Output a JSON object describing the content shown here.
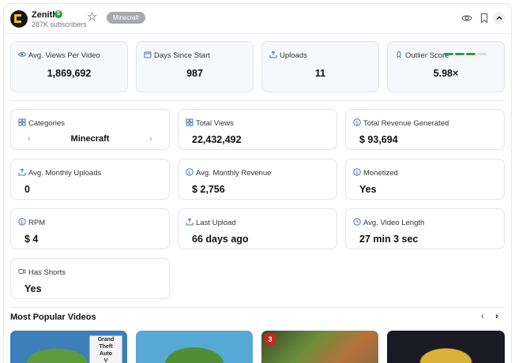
{
  "header": {
    "channel_name": "Zenith",
    "subscribers": "287K subscribers",
    "tag": "Minecraft",
    "verified_symbol": "$"
  },
  "top_stats": [
    {
      "label": "Avg. Views Per Video",
      "value": "1,869,692",
      "icon": "eye-icon"
    },
    {
      "label": "Days Since Start",
      "value": "987",
      "icon": "calendar-icon"
    },
    {
      "label": "Uploads",
      "value": "11",
      "icon": "upload-icon"
    },
    {
      "label": "Outlier Score",
      "value": "5.98×",
      "icon": "rocket-icon",
      "score_level": 0.75
    }
  ],
  "categories": {
    "label": "Categories",
    "value": "Minecraft"
  },
  "stats": [
    {
      "label": "Total Views",
      "value": "22,432,492",
      "icon": "grid-icon"
    },
    {
      "label": "Total Revenue Generated",
      "value": "$ 93,694",
      "icon": "dollar-icon"
    },
    {
      "label": "Avg. Monthly Uploads",
      "value": "0",
      "icon": "upload-icon"
    },
    {
      "label": "Avg. Monthly Revenue",
      "value": "$ 2,756",
      "icon": "dollar-icon"
    },
    {
      "label": "Monetized",
      "value": "Yes",
      "icon": "dollar-icon"
    },
    {
      "label": "RPM",
      "value": "$ 4",
      "icon": "dollar-icon"
    },
    {
      "label": "Last Upload",
      "value": "66 days ago",
      "icon": "upload-icon"
    },
    {
      "label": "Avg. Video Length",
      "value": "27 min 3 sec",
      "icon": "clock-icon"
    },
    {
      "label": "Has Shorts",
      "value": "Yes",
      "icon": "video-icon"
    }
  ],
  "popular": {
    "title": "Most Popular Videos",
    "thumb1_text": [
      "Grand",
      "Theft",
      "Auto",
      "V"
    ],
    "thumb3_badge": "3"
  },
  "colors": {
    "accent_blue": "#4b74b5",
    "verified_green": "#22a447",
    "score_green": "#2a9d3a",
    "tag_gray": "#a7a9ad"
  }
}
